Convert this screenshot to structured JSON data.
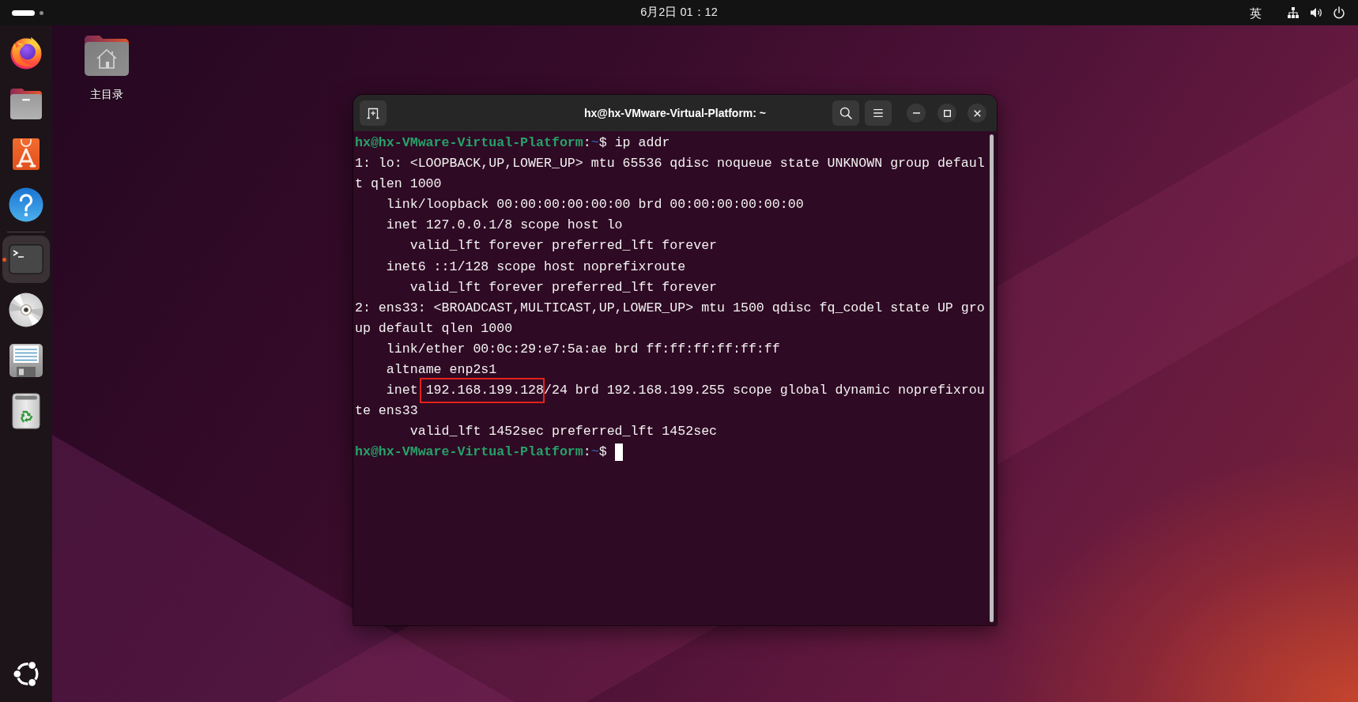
{
  "top_bar": {
    "workspaces": [
      {
        "selected": true
      },
      {
        "selected": false
      }
    ],
    "clock": "6月2日 01：12",
    "input_method": "英"
  },
  "dock": {
    "groups": [
      {
        "items": [
          {
            "kind": "browser",
            "running": false,
            "focused": false
          },
          {
            "kind": "files",
            "running": false,
            "focused": false
          },
          {
            "kind": "store",
            "running": false,
            "focused": false
          },
          {
            "kind": "help",
            "running": false,
            "focused": false
          }
        ]
      },
      {
        "items": [
          {
            "kind": "terminal",
            "running": true,
            "focused": true
          },
          {
            "kind": "disc",
            "running": false,
            "focused": false
          },
          {
            "kind": "document",
            "running": false,
            "focused": false
          },
          {
            "kind": "trash",
            "running": false,
            "focused": false
          }
        ]
      }
    ]
  },
  "desktop": {
    "icons": [
      {
        "label": "主目录"
      }
    ]
  },
  "terminal": {
    "title": "hx@hx-VMware-Virtual-Platform: ~",
    "lines": [
      {
        "kind": "prompt",
        "user": "hx@hx-VMware-Virtual-Platform",
        "separator": ":",
        "path": "~",
        "symbol": "$",
        "command": "ip addr",
        "cursor": false
      },
      {
        "kind": "output",
        "text": "1: lo: <LOOPBACK,UP,LOWER_UP> mtu 65536 qdisc noqueue state UNKNOWN group defaul"
      },
      {
        "kind": "output",
        "text": "t qlen 1000"
      },
      {
        "kind": "output",
        "text": "    link/loopback 00:00:00:00:00:00 brd 00:00:00:00:00:00"
      },
      {
        "kind": "output",
        "text": "    inet 127.0.0.1/8 scope host lo"
      },
      {
        "kind": "output",
        "text": "       valid_lft forever preferred_lft forever"
      },
      {
        "kind": "output",
        "text": "    inet6 ::1/128 scope host noprefixroute"
      },
      {
        "kind": "output",
        "text": "       valid_lft forever preferred_lft forever"
      },
      {
        "kind": "output",
        "text": "2: ens33: <BROADCAST,MULTICAST,UP,LOWER_UP> mtu 1500 qdisc fq_codel state UP gro"
      },
      {
        "kind": "output",
        "text": "up default qlen 1000"
      },
      {
        "kind": "output",
        "text": "    link/ether 00:0c:29:e7:5a:ae brd ff:ff:ff:ff:ff:ff"
      },
      {
        "kind": "output",
        "text": "    altname enp2s1"
      },
      {
        "kind": "annotated",
        "segments": [
          {
            "text": "    inet ",
            "highlighted": false
          },
          {
            "text": "192.168.199.128",
            "highlighted": true
          },
          {
            "text": "/24 brd 192.168.199.255 scope global dynamic noprefixrou",
            "highlighted": false
          }
        ]
      },
      {
        "kind": "output",
        "text": "te ens33"
      },
      {
        "kind": "output",
        "text": "       valid_lft 1452sec preferred_lft 1452sec"
      },
      {
        "kind": "prompt",
        "user": "hx@hx-VMware-Virtual-Platform",
        "separator": ":",
        "path": "~",
        "symbol": "$",
        "cursor": true
      }
    ]
  }
}
